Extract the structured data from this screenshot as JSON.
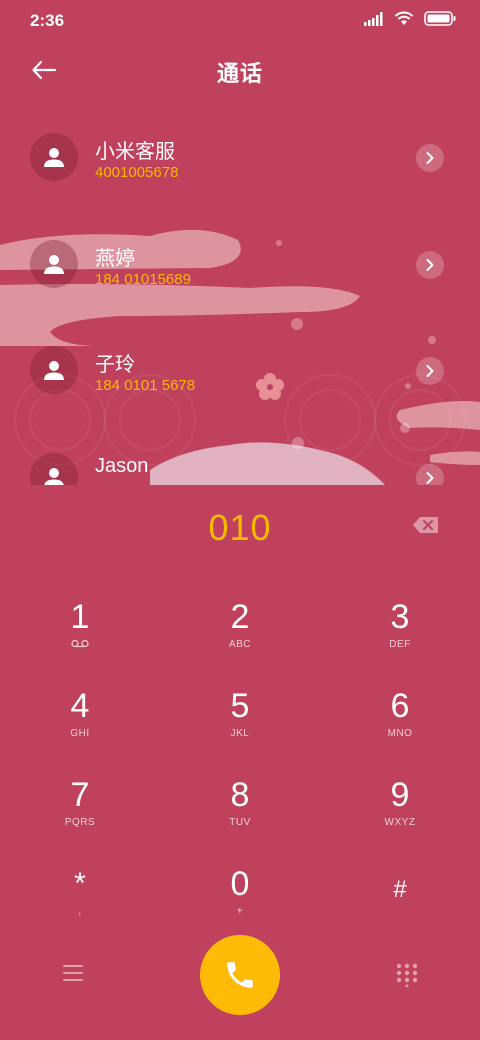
{
  "status": {
    "time": "2:36"
  },
  "header": {
    "title": "通话"
  },
  "contacts": [
    {
      "name": "小米客服",
      "number": "4001005678"
    },
    {
      "name": "燕婷",
      "number": "184 01015689"
    },
    {
      "name": "子玲",
      "number": "184 0101 5678"
    },
    {
      "name": "Jason",
      "number": ""
    }
  ],
  "dialpad": {
    "input": "010",
    "keys": [
      {
        "digit": "1",
        "letters": ""
      },
      {
        "digit": "2",
        "letters": "ABC"
      },
      {
        "digit": "3",
        "letters": "DEF"
      },
      {
        "digit": "4",
        "letters": "GHI"
      },
      {
        "digit": "5",
        "letters": "JKL"
      },
      {
        "digit": "6",
        "letters": "MNO"
      },
      {
        "digit": "7",
        "letters": "PQRS"
      },
      {
        "digit": "8",
        "letters": "TUV"
      },
      {
        "digit": "9",
        "letters": "WXYZ"
      },
      {
        "digit": "*",
        "letters": ","
      },
      {
        "digit": "0",
        "letters": "+"
      },
      {
        "digit": "#",
        "letters": ""
      }
    ]
  },
  "colors": {
    "background": "#c0415d",
    "accent_yellow": "#f7b900",
    "call_button": "#fdbb05"
  },
  "icons": {
    "back": "back-arrow-icon",
    "delete": "backspace-icon",
    "menu": "menu-icon",
    "call": "phone-icon",
    "keypad": "keypad-icon",
    "voicemail": "voicemail-icon"
  }
}
